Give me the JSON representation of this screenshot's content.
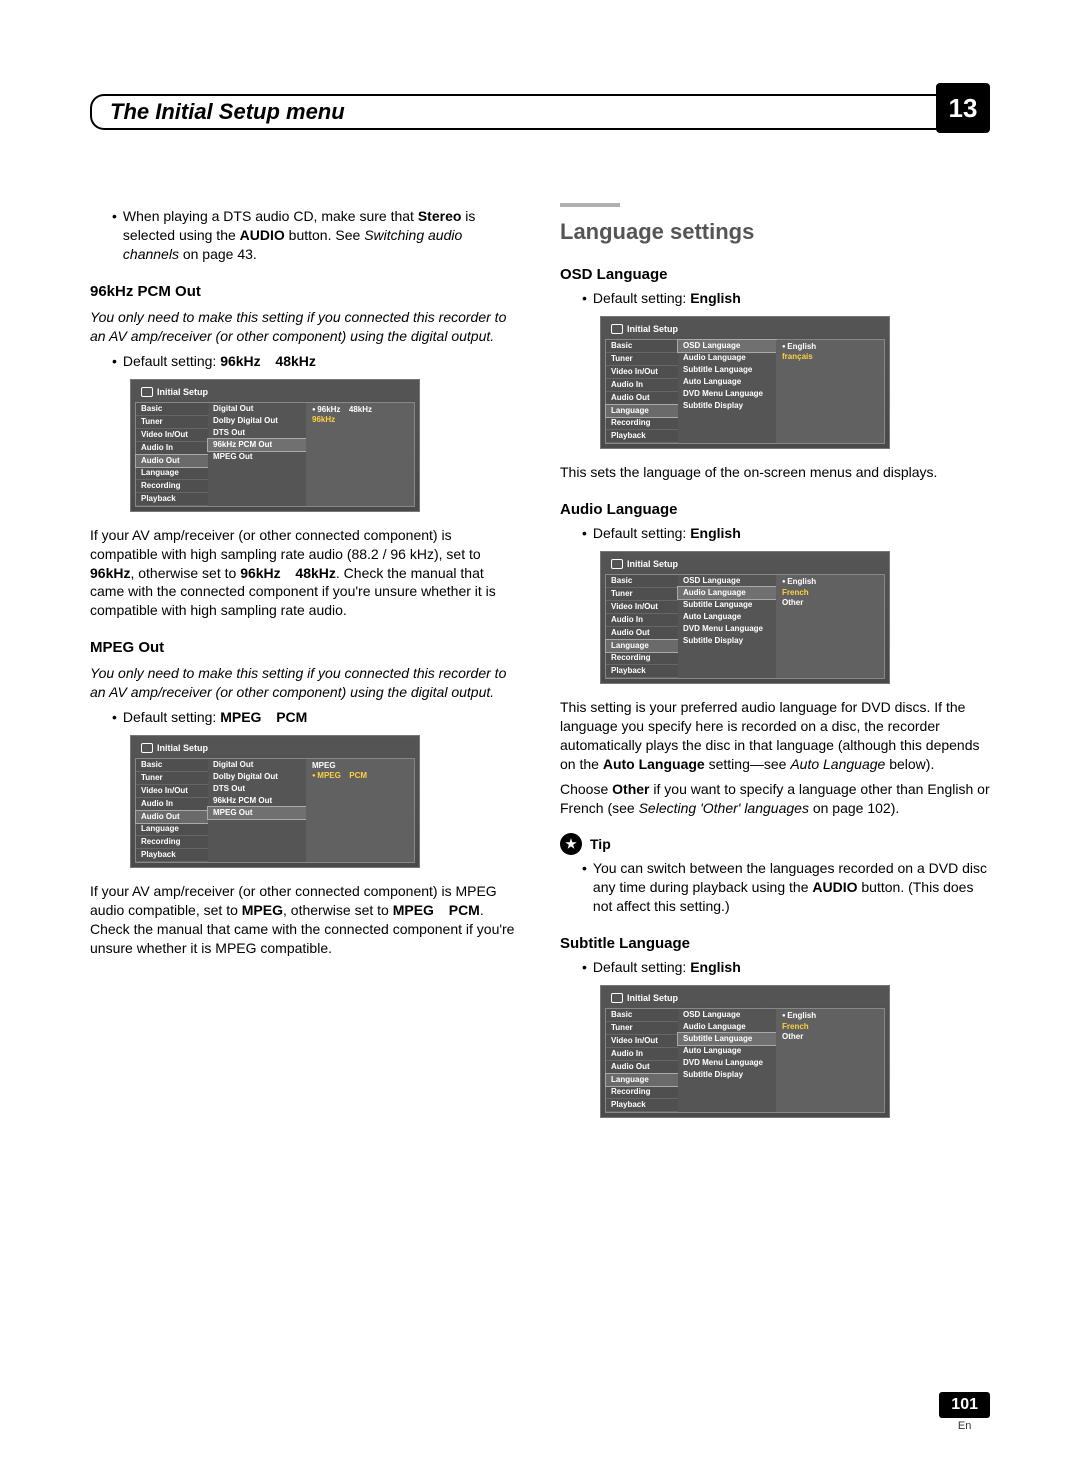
{
  "chapter": {
    "title": "The Initial Setup menu",
    "number": "13"
  },
  "left": {
    "intro_bullet": "When playing a DTS audio CD, make sure that <strong>Stereo</strong> is selected using the <strong>AUDIO</strong> button. See <em>Switching audio channels</em> on page 43.",
    "s96": {
      "heading": "96kHz PCM Out",
      "note": "You only need to make this setting if you connected this recorder to an AV amp/receiver (or other component) using the digital output.",
      "default_label": "Default setting: ",
      "default_value": "96kHz   48kHz",
      "osd": {
        "title": "Initial Setup",
        "nav": [
          "Basic",
          "Tuner",
          "Video In/Out",
          "Audio In",
          "Audio Out",
          "Language",
          "Recording",
          "Playback"
        ],
        "nav_selected": "Audio Out",
        "mid": [
          "Digital Out",
          "Dolby Digital Out",
          "DTS Out",
          "96kHz PCM Out",
          "MPEG Out"
        ],
        "mid_selected": "96kHz PCM Out",
        "opts": [
          {
            "label": "96kHz   48kHz",
            "dot": true,
            "sel": false
          },
          {
            "label": "96kHz",
            "dot": false,
            "sel": true
          }
        ]
      },
      "after": "If your AV amp/receiver (or other connected component) is compatible with high sampling rate audio (88.2 / 96 kHz), set to <strong>96kHz</strong>, otherwise set to <strong>96kHz   48kHz</strong>. Check the manual that came with the connected component if you're unsure whether it is compatible with high sampling rate audio."
    },
    "mpeg": {
      "heading": "MPEG Out",
      "note": "You only need to make this setting if you connected this recorder to an AV amp/receiver (or other component) using the digital output.",
      "default_label": "Default setting: ",
      "default_value": "MPEG   PCM",
      "osd": {
        "title": "Initial Setup",
        "nav": [
          "Basic",
          "Tuner",
          "Video In/Out",
          "Audio In",
          "Audio Out",
          "Language",
          "Recording",
          "Playback"
        ],
        "nav_selected": "Audio Out",
        "mid": [
          "Digital Out",
          "Dolby Digital Out",
          "DTS Out",
          "96kHz PCM Out",
          "MPEG Out"
        ],
        "mid_selected": "MPEG Out",
        "opts": [
          {
            "label": "MPEG",
            "dot": false,
            "sel": false
          },
          {
            "label": "MPEG   PCM",
            "dot": true,
            "sel": true
          }
        ]
      },
      "after": "If your AV amp/receiver (or other connected component) is MPEG audio compatible, set to <strong>MPEG</strong>, otherwise set to <strong>MPEG   PCM</strong>. Check the manual that came with the connected component if you're unsure whether it is MPEG compatible."
    }
  },
  "right": {
    "section_heading": "Language settings",
    "osd_lang": {
      "heading": "OSD Language",
      "default_label": "Default setting: ",
      "default_value": "English",
      "osd": {
        "title": "Initial Setup",
        "nav": [
          "Basic",
          "Tuner",
          "Video In/Out",
          "Audio In",
          "Audio Out",
          "Language",
          "Recording",
          "Playback"
        ],
        "nav_selected": "Language",
        "mid": [
          "OSD Language",
          "Audio Language",
          "Subtitle Language",
          "Auto Language",
          "DVD Menu Language",
          "Subtitle Display"
        ],
        "mid_selected": "OSD Language",
        "opts": [
          {
            "label": "English",
            "dot": true,
            "sel": false
          },
          {
            "label": "français",
            "dot": false,
            "sel": true
          }
        ]
      },
      "after": "This sets the language of the on-screen menus and displays."
    },
    "audio_lang": {
      "heading": "Audio Language",
      "default_label": "Default setting: ",
      "default_value": "English",
      "osd": {
        "title": "Initial Setup",
        "nav": [
          "Basic",
          "Tuner",
          "Video In/Out",
          "Audio In",
          "Audio Out",
          "Language",
          "Recording",
          "Playback"
        ],
        "nav_selected": "Language",
        "mid": [
          "OSD Language",
          "Audio Language",
          "Subtitle Language",
          "Auto Language",
          "DVD Menu Language",
          "Subtitle Display"
        ],
        "mid_selected": "Audio Language",
        "opts": [
          {
            "label": "English",
            "dot": true,
            "sel": false
          },
          {
            "label": "French",
            "dot": false,
            "sel": true
          },
          {
            "label": "Other",
            "dot": false,
            "sel": false
          }
        ]
      },
      "after1": "This setting is your preferred audio language for DVD discs. If the language you specify here is recorded on a disc, the recorder automatically plays the disc in that language (although this depends on the <strong>Auto Language</strong> setting—see <em>Auto Language</em> below).",
      "after2": "Choose <strong>Other</strong> if you want to specify a language other than English or French (see <em>Selecting 'Other' languages</em> on page 102).",
      "tip_label": "Tip",
      "tip_text": "You can switch between the languages recorded on a DVD disc any time during playback using the <strong>AUDIO</strong> button. (This does not affect this setting.)"
    },
    "sub_lang": {
      "heading": "Subtitle Language",
      "default_label": "Default setting: ",
      "default_value": "English",
      "osd": {
        "title": "Initial Setup",
        "nav": [
          "Basic",
          "Tuner",
          "Video In/Out",
          "Audio In",
          "Audio Out",
          "Language",
          "Recording",
          "Playback"
        ],
        "nav_selected": "Language",
        "mid": [
          "OSD Language",
          "Audio Language",
          "Subtitle Language",
          "Auto Language",
          "DVD Menu Language",
          "Subtitle Display"
        ],
        "mid_selected": "Subtitle Language",
        "opts": [
          {
            "label": "English",
            "dot": true,
            "sel": false
          },
          {
            "label": "French",
            "dot": false,
            "sel": true
          },
          {
            "label": "Other",
            "dot": false,
            "sel": false
          }
        ]
      }
    }
  },
  "footer": {
    "page": "101",
    "lang": "En"
  }
}
